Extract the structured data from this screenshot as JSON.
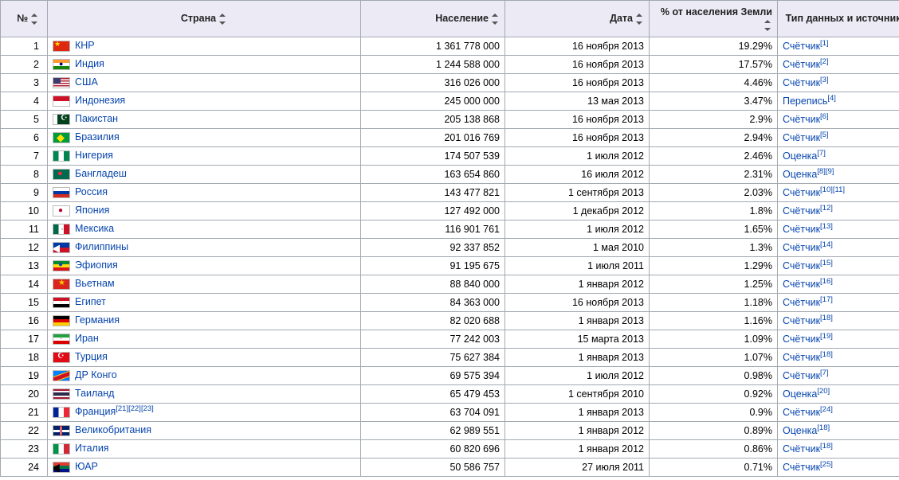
{
  "columns": {
    "rank": "№",
    "country": "Страна",
    "population": "Население",
    "date": "Дата",
    "percent": "% от населения Земли",
    "source": "Тип данных и источник"
  },
  "rows": [
    {
      "rank": "1",
      "flag": "flag-cn",
      "country": "КНР",
      "population": "1 361 778 000",
      "date": "16 ноября 2013",
      "percent": "19.29%",
      "source": "Счётчик",
      "refs": [
        "[1]"
      ]
    },
    {
      "rank": "2",
      "flag": "flag-in",
      "country": "Индия",
      "population": "1 244 588 000",
      "date": "16 ноября 2013",
      "percent": "17.57%",
      "source": "Счётчик",
      "refs": [
        "[2]"
      ]
    },
    {
      "rank": "3",
      "flag": "flag-us",
      "country": "США",
      "population": "316 026 000",
      "date": "16 ноября 2013",
      "percent": "4.46%",
      "source": "Счётчик",
      "refs": [
        "[3]"
      ]
    },
    {
      "rank": "4",
      "flag": "flag-id",
      "country": "Индонезия",
      "population": "245 000 000",
      "date": "13 мая 2013",
      "percent": "3.47%",
      "source": "Перепись",
      "refs": [
        "[4]"
      ]
    },
    {
      "rank": "5",
      "flag": "flag-pk",
      "country": "Пакистан",
      "population": "205 138 868",
      "date": "16 ноября 2013",
      "percent": "2.9%",
      "source": "Счётчик",
      "refs": [
        "[6]"
      ]
    },
    {
      "rank": "6",
      "flag": "flag-br",
      "country": "Бразилия",
      "population": "201 016 769",
      "date": "16 ноября 2013",
      "percent": "2.94%",
      "source": "Счётчик",
      "refs": [
        "[5]"
      ]
    },
    {
      "rank": "7",
      "flag": "flag-ng",
      "country": "Нигерия",
      "population": "174 507 539",
      "date": "1 июля 2012",
      "percent": "2.46%",
      "source": "Оценка",
      "refs": [
        "[7]"
      ]
    },
    {
      "rank": "8",
      "flag": "flag-bd",
      "country": "Бангладеш",
      "population": "163 654 860",
      "date": "16 июля 2012",
      "percent": "2.31%",
      "source": "Оценка",
      "refs": [
        "[8]",
        "[9]"
      ]
    },
    {
      "rank": "9",
      "flag": "flag-ru",
      "country": "Россия",
      "population": "143 477 821",
      "date": "1 сентября 2013",
      "percent": "2.03%",
      "source": "Счётчик",
      "refs": [
        "[10]",
        "[11]"
      ]
    },
    {
      "rank": "10",
      "flag": "flag-jp",
      "country": "Япония",
      "population": "127 492 000",
      "date": "1 декабря 2012",
      "percent": "1.8%",
      "source": "Счётчик",
      "refs": [
        "[12]"
      ]
    },
    {
      "rank": "11",
      "flag": "flag-mx",
      "country": "Мексика",
      "population": "116 901 761",
      "date": "1 июля 2012",
      "percent": "1.65%",
      "source": "Счётчик",
      "refs": [
        "[13]"
      ]
    },
    {
      "rank": "12",
      "flag": "flag-ph",
      "country": "Филиппины",
      "population": "92 337 852",
      "date": "1 мая 2010",
      "percent": "1.3%",
      "source": "Счётчик",
      "refs": [
        "[14]"
      ]
    },
    {
      "rank": "13",
      "flag": "flag-et",
      "country": "Эфиопия",
      "population": "91 195 675",
      "date": "1 июля 2011",
      "percent": "1.29%",
      "source": "Счётчик",
      "refs": [
        "[15]"
      ]
    },
    {
      "rank": "14",
      "flag": "flag-vn",
      "country": "Вьетнам",
      "population": "88 840 000",
      "date": "1 января 2012",
      "percent": "1.25%",
      "source": "Счётчик",
      "refs": [
        "[16]"
      ]
    },
    {
      "rank": "15",
      "flag": "flag-eg",
      "country": "Египет",
      "population": "84 363 000",
      "date": "16 ноября 2013",
      "percent": "1.18%",
      "source": "Счётчик",
      "refs": [
        "[17]"
      ]
    },
    {
      "rank": "16",
      "flag": "flag-de",
      "country": "Германия",
      "population": "82 020 688",
      "date": "1 января 2013",
      "percent": "1.16%",
      "source": "Счётчик",
      "refs": [
        "[18]"
      ]
    },
    {
      "rank": "17",
      "flag": "flag-ir",
      "country": "Иран",
      "population": "77 242 003",
      "date": "15 марта 2013",
      "percent": "1.09%",
      "source": "Счётчик",
      "refs": [
        "[19]"
      ]
    },
    {
      "rank": "18",
      "flag": "flag-tr",
      "country": "Турция",
      "population": "75 627 384",
      "date": "1 января 2013",
      "percent": "1.07%",
      "source": "Счётчик",
      "refs": [
        "[18]"
      ]
    },
    {
      "rank": "19",
      "flag": "flag-cd",
      "country": "ДР Конго",
      "population": "69 575 394",
      "date": "1 июля 2012",
      "percent": "0.98%",
      "source": "Счётчик",
      "refs": [
        "[7]"
      ]
    },
    {
      "rank": "20",
      "flag": "flag-th",
      "country": "Таиланд",
      "population": "65 479 453",
      "date": "1 сентября 2010",
      "percent": "0.92%",
      "source": "Оценка",
      "refs": [
        "[20]"
      ]
    },
    {
      "rank": "21",
      "flag": "flag-fr",
      "country": "Франция",
      "country_refs": [
        "[21]",
        "[22]",
        "[23]"
      ],
      "population": "63 704 091",
      "date": "1 января 2013",
      "percent": "0.9%",
      "source": "Счётчик",
      "refs": [
        "[24]"
      ]
    },
    {
      "rank": "22",
      "flag": "flag-gb",
      "country": "Великобритания",
      "population": "62 989 551",
      "date": "1 января 2012",
      "percent": "0.89%",
      "source": "Оценка",
      "refs": [
        "[18]"
      ]
    },
    {
      "rank": "23",
      "flag": "flag-it",
      "country": "Италия",
      "population": "60 820 696",
      "date": "1 января 2012",
      "percent": "0.86%",
      "source": "Счётчик",
      "refs": [
        "[18]"
      ]
    },
    {
      "rank": "24",
      "flag": "flag-za",
      "country": "ЮАР",
      "population": "50 586 757",
      "date": "27 июля 2011",
      "percent": "0.71%",
      "source": "Счётчик",
      "refs": [
        "[25]"
      ]
    }
  ]
}
